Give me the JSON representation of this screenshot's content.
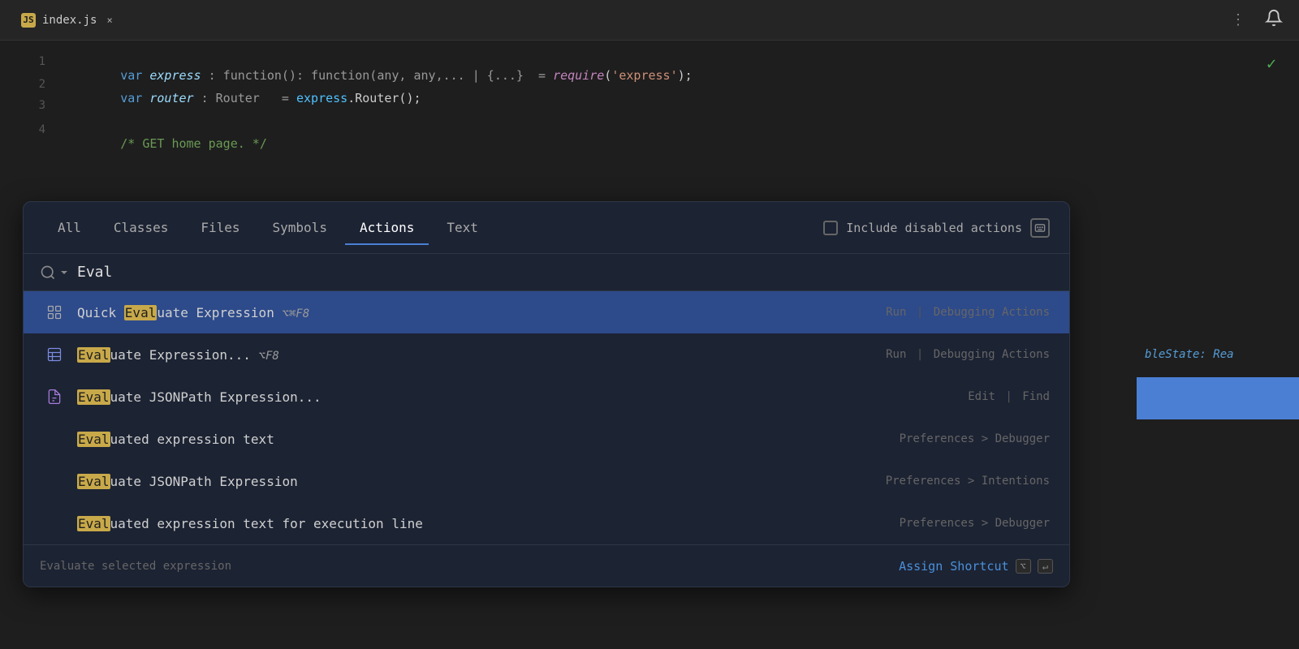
{
  "tab": {
    "icon": "JS",
    "filename": "index.js",
    "close_label": "×"
  },
  "toolbar": {
    "menu_dots": "⋮",
    "notification_bell": "🔔",
    "check_mark": "✓"
  },
  "code_lines": [
    {
      "num": "1",
      "parts": [
        {
          "text": "var ",
          "class": "kw"
        },
        {
          "text": "express",
          "class": "var-name"
        },
        {
          "text": " : function(): function(any, any,... | {...}  = ",
          "class": "type-hint"
        },
        {
          "text": "require",
          "class": "require-kw"
        },
        {
          "text": "('express');",
          "class": "str"
        }
      ]
    },
    {
      "num": "2",
      "parts": [
        {
          "text": "var ",
          "class": "kw"
        },
        {
          "text": "router",
          "class": "var-name"
        },
        {
          "text": " : Router   = ",
          "class": "type-hint"
        },
        {
          "text": "express",
          "class": "fn"
        },
        {
          "text": ".Router();",
          "class": "punct"
        }
      ]
    },
    {
      "num": "3",
      "parts": []
    },
    {
      "num": "4",
      "parts": [
        {
          "text": "/* GET home page. */",
          "class": "comment"
        }
      ]
    }
  ],
  "right_partial_text": "bleState: Rea",
  "search": {
    "tabs": [
      {
        "label": "All",
        "active": false
      },
      {
        "label": "Classes",
        "active": false
      },
      {
        "label": "Files",
        "active": false
      },
      {
        "label": "Symbols",
        "active": false
      },
      {
        "label": "Actions",
        "active": true
      },
      {
        "label": "Text",
        "active": false
      }
    ],
    "include_disabled_label": "Include disabled actions",
    "search_icon": "🔍",
    "search_arrow": "▾",
    "query": "Eval",
    "placeholder": ""
  },
  "results": [
    {
      "id": "r1",
      "selected": true,
      "icon": "grid",
      "icon_color": "#888",
      "name_before": "Quick ",
      "name_highlight": "Eval",
      "name_after": "uate Expression",
      "shortcut": "⌥⌘F8",
      "category": "Run | Debugging Actions"
    },
    {
      "id": "r2",
      "selected": false,
      "icon": "table",
      "icon_color": "#7b8cde",
      "name_before": "",
      "name_highlight": "Eval",
      "name_after": "uate Expression...",
      "shortcut": "⌥F8",
      "category": "Run | Debugging Actions"
    },
    {
      "id": "r3",
      "selected": false,
      "icon": "braces",
      "icon_color": "#a87cde",
      "name_before": "",
      "name_highlight": "Eval",
      "name_after": "uate JSONPath Expression...",
      "shortcut": "",
      "category": "Edit | Find"
    },
    {
      "id": "r4",
      "selected": false,
      "icon": "none",
      "icon_color": "",
      "name_before": "",
      "name_highlight": "Eval",
      "name_after": "uated expression text",
      "shortcut": "",
      "category": "Preferences > Debugger"
    },
    {
      "id": "r5",
      "selected": false,
      "icon": "none",
      "icon_color": "",
      "name_before": "",
      "name_highlight": "Eval",
      "name_after": "uate JSONPath Expression",
      "shortcut": "",
      "category": "Preferences > Intentions"
    },
    {
      "id": "r6",
      "selected": false,
      "icon": "none",
      "icon_color": "",
      "name_before": "",
      "name_highlight": "Eval",
      "name_after": "uated expression text for execution line",
      "shortcut": "",
      "category": "Preferences > Debugger"
    }
  ],
  "bottom": {
    "description": "Evaluate selected expression",
    "assign_shortcut_label": "Assign Shortcut",
    "shortcut_key1": "⌥",
    "shortcut_key2": "↵"
  }
}
